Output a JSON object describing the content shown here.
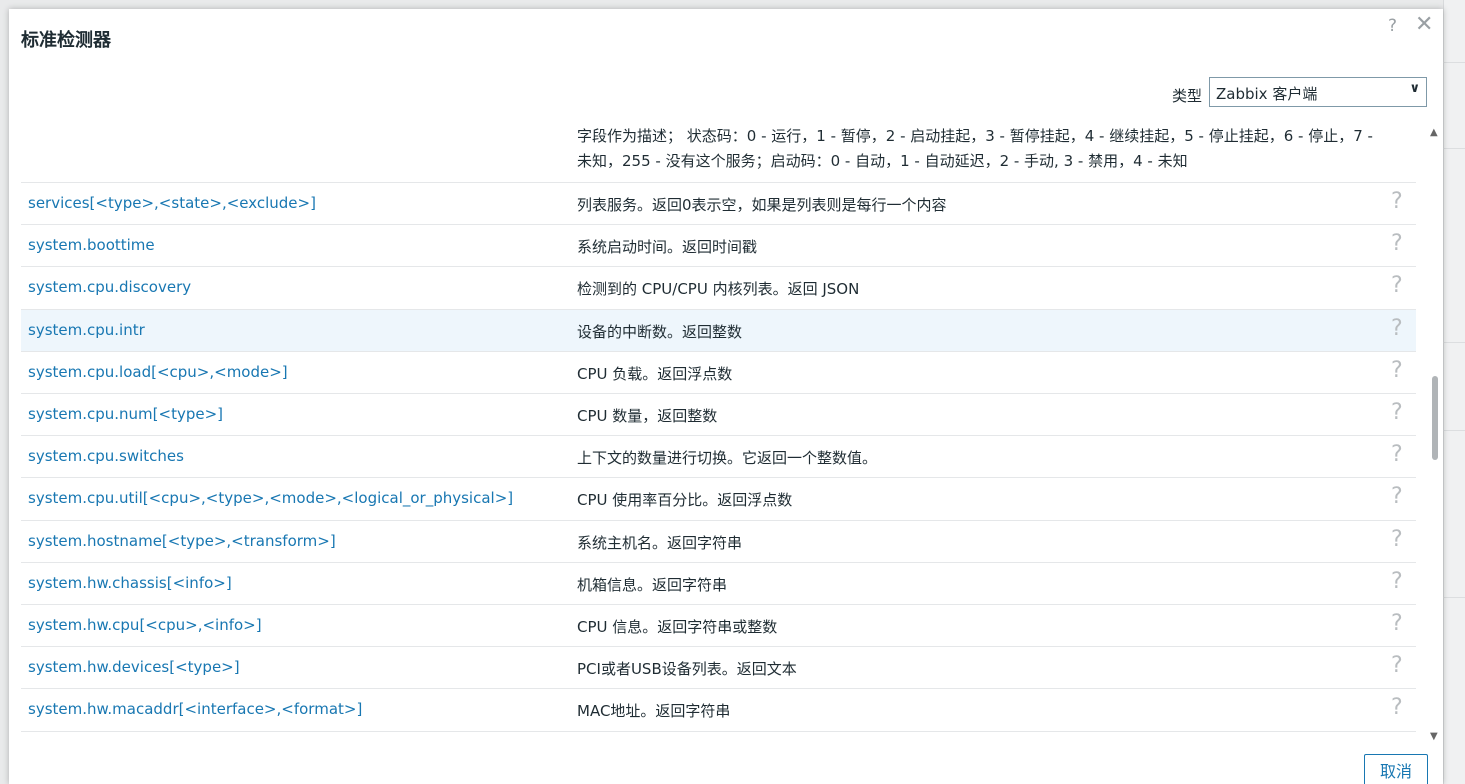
{
  "dialog": {
    "title": "标准检测器",
    "help_glyph": "?",
    "close_glyph": "✕",
    "type_label": "类型",
    "type_value": "Zabbix 客户端",
    "first_description": "字段作为描述； 状态码：0 - 运行，1 - 暂停，2 - 启动挂起，3 - 暂停挂起，4 - 继续挂起，5 - 停止挂起，6 - 停止，7 - 未知，255 - 没有这个服务；启动码：0 - 自动，1 - 自动延迟，2 - 手动, 3 - 禁用，4 - 未知",
    "cancel_label": "取消"
  },
  "items": [
    {
      "key": "services[<type>,<state>,<exclude>]",
      "description": "列表服务。返回0表示空，如果是列表则是每行一个内容",
      "help": "?"
    },
    {
      "key": "system.boottime",
      "description": "系统启动时间。返回时间戳",
      "help": "?"
    },
    {
      "key": "system.cpu.discovery",
      "description": "检测到的 CPU/CPU 内核列表。返回 JSON",
      "help": "?"
    },
    {
      "key": "system.cpu.intr",
      "description": "设备的中断数。返回整数",
      "help": "?"
    },
    {
      "key": "system.cpu.load[<cpu>,<mode>]",
      "description": "CPU 负载。返回浮点数",
      "help": "?"
    },
    {
      "key": "system.cpu.num[<type>]",
      "description": "CPU 数量，返回整数",
      "help": "?"
    },
    {
      "key": "system.cpu.switches",
      "description": "上下文的数量进行切换。它返回一个整数值。",
      "help": "?"
    },
    {
      "key": "system.cpu.util[<cpu>,<type>,<mode>,<logical_or_physical>]",
      "description": "CPU 使用率百分比。返回浮点数",
      "help": "?"
    },
    {
      "key": "system.hostname[<type>,<transform>]",
      "description": "系统主机名。返回字符串",
      "help": "?"
    },
    {
      "key": "system.hw.chassis[<info>]",
      "description": "机箱信息。返回字符串",
      "help": "?"
    },
    {
      "key": "system.hw.cpu[<cpu>,<info>]",
      "description": "CPU 信息。返回字符串或整数",
      "help": "?"
    },
    {
      "key": "system.hw.devices[<type>]",
      "description": "PCI或者USB设备列表。返回文本",
      "help": "?"
    },
    {
      "key": "system.hw.macaddr[<interface>,<format>]",
      "description": "MAC地址。返回字符串",
      "help": "?"
    }
  ],
  "highlighted_row": 3,
  "colors": {
    "link": "#1877b2",
    "highlight": "#eef6fc"
  }
}
